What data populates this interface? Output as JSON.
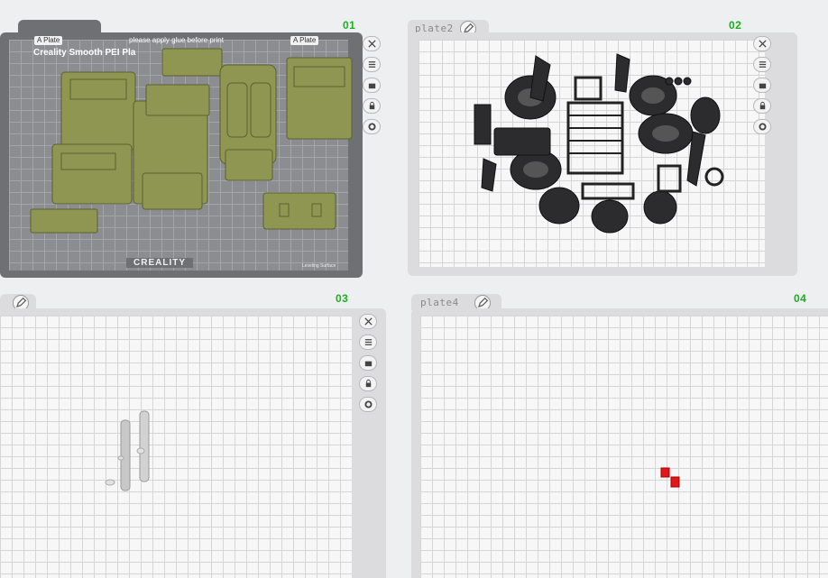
{
  "plates": [
    {
      "number": "01",
      "name": "",
      "plate_label_left": "A Plate",
      "plate_label_right": "A Plate",
      "plate_notice": "please apply glue before print",
      "plate_title": "Creality Smooth PEI Pla",
      "brand": "CREALITY",
      "corner_note": "Leveling Surface",
      "model_color": "#8f9652"
    },
    {
      "number": "02",
      "name": "plate2",
      "model_color": "#2c2c2e"
    },
    {
      "number": "03",
      "name": "",
      "model_color": "#c8c8c8"
    },
    {
      "number": "04",
      "name": "plate4",
      "model_color": "#e01818"
    }
  ],
  "tools": [
    {
      "icon": "close-icon"
    },
    {
      "icon": "list-icon"
    },
    {
      "icon": "auto-arrange-icon",
      "label": "AUTO"
    },
    {
      "icon": "lock-icon"
    },
    {
      "icon": "gear-icon"
    }
  ]
}
